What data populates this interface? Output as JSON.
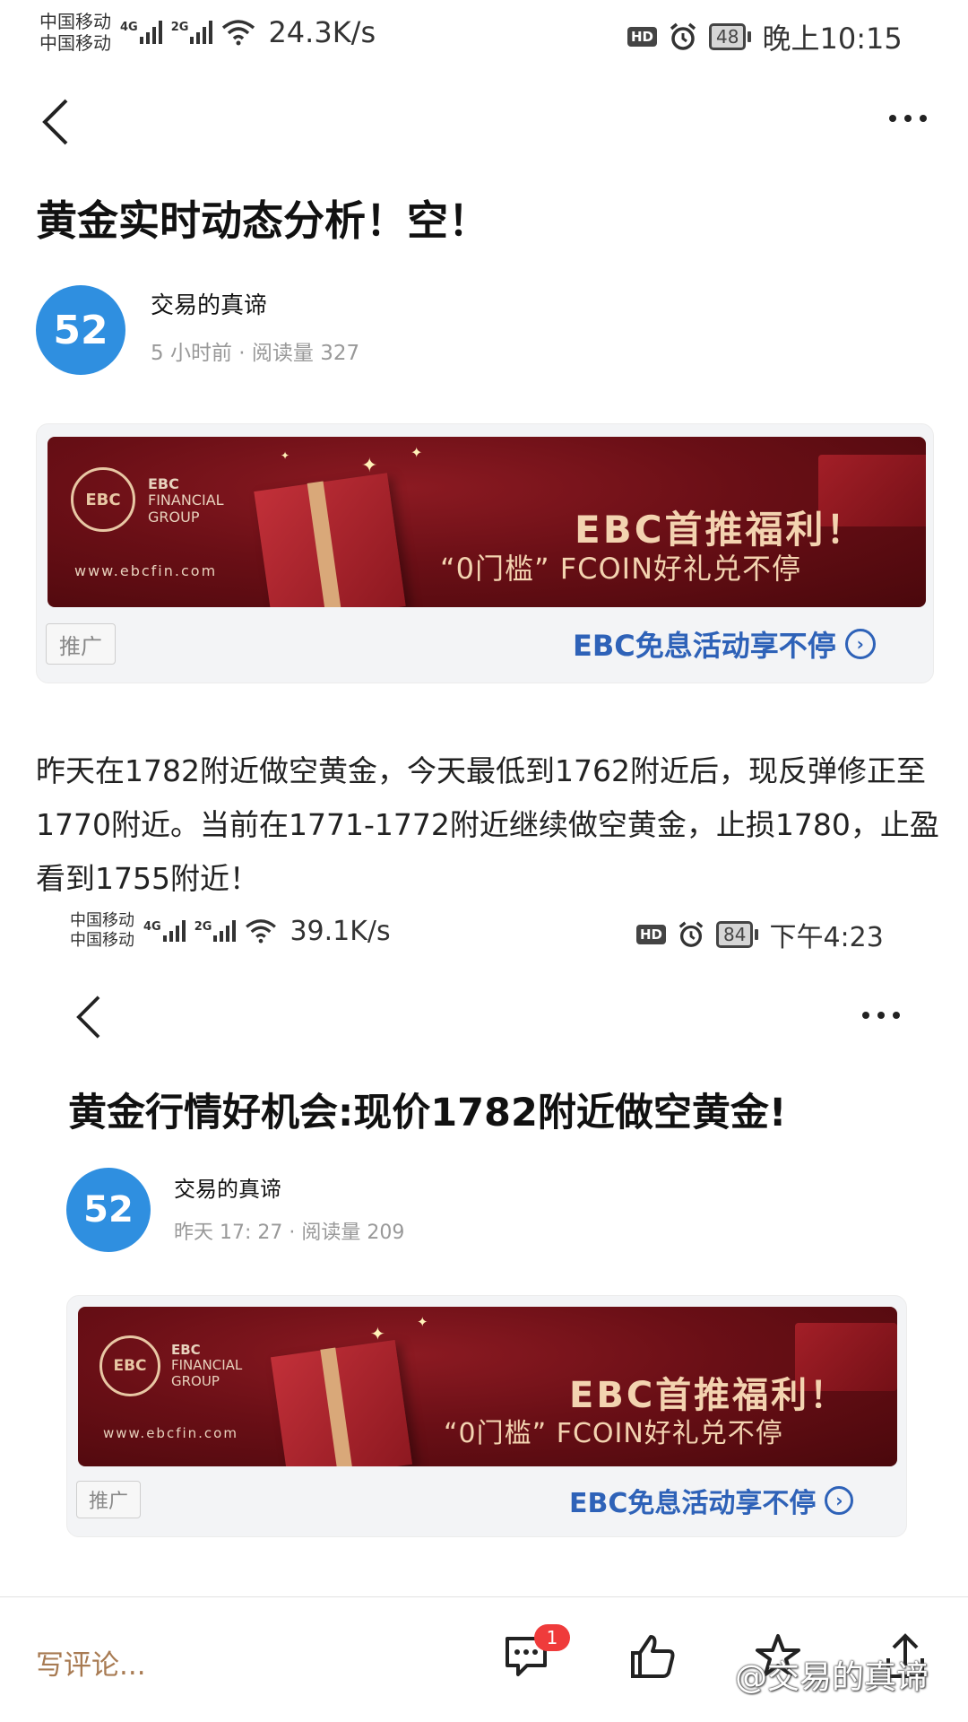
{
  "shot1": {
    "status": {
      "carrier1": "中国移动",
      "carrier2": "中国移动",
      "gen1": "4G",
      "gen2": "2G",
      "speed": "24.3K/s",
      "hd": "HD",
      "battery": "48",
      "time": "晚上10:15"
    },
    "title": "黄金实时动态分析！空！",
    "avatar": "52",
    "author": "交易的真谛",
    "meta": "5 小时前 · 阅读量 327",
    "ad": {
      "logo": "EBC",
      "logo_line1": "EBC",
      "logo_line2": "FINANCIAL",
      "logo_line3": "GROUP",
      "url": "www.ebcfin.com",
      "headline": "EBC首推福利！",
      "sub": "“0门槛” FCOIN好礼兑不停",
      "tag": "推广",
      "link": "EBC免息活动享不停"
    },
    "body": "昨天在1782附近做空黄金，今天最低到1762附近后，现反弹修正至1770附近。当前在1771-1772附近继续做空黄金，止损1780，止盈看到1755附近！"
  },
  "shot2": {
    "status": {
      "carrier1": "中国移动",
      "carrier2": "中国移动",
      "gen1": "4G",
      "gen2": "2G",
      "speed": "39.1K/s",
      "hd": "HD",
      "battery": "84",
      "time": "下午4:23"
    },
    "title": "黄金行情好机会:现价1782附近做空黄金!",
    "avatar": "52",
    "author": "交易的真谛",
    "meta": "昨天 17: 27 · 阅读量 209",
    "ad": {
      "logo": "EBC",
      "logo_line1": "EBC",
      "logo_line2": "FINANCIAL",
      "logo_line3": "GROUP",
      "url": "www.ebcfin.com",
      "headline": "EBC首推福利！",
      "sub": "“0门槛” FCOIN好礼兑不停",
      "tag": "推广",
      "link": "EBC免息活动享不停"
    }
  },
  "bottom": {
    "comment_placeholder": "写评论...",
    "comment_badge": "1",
    "watermark": "@交易的真谛"
  },
  "colors": {
    "avatar": "#2f8fe0",
    "ad_link": "#2e62b8",
    "banner": "#6a0f16",
    "comment_text": "#a87b53",
    "badge": "#ef3b3b"
  }
}
